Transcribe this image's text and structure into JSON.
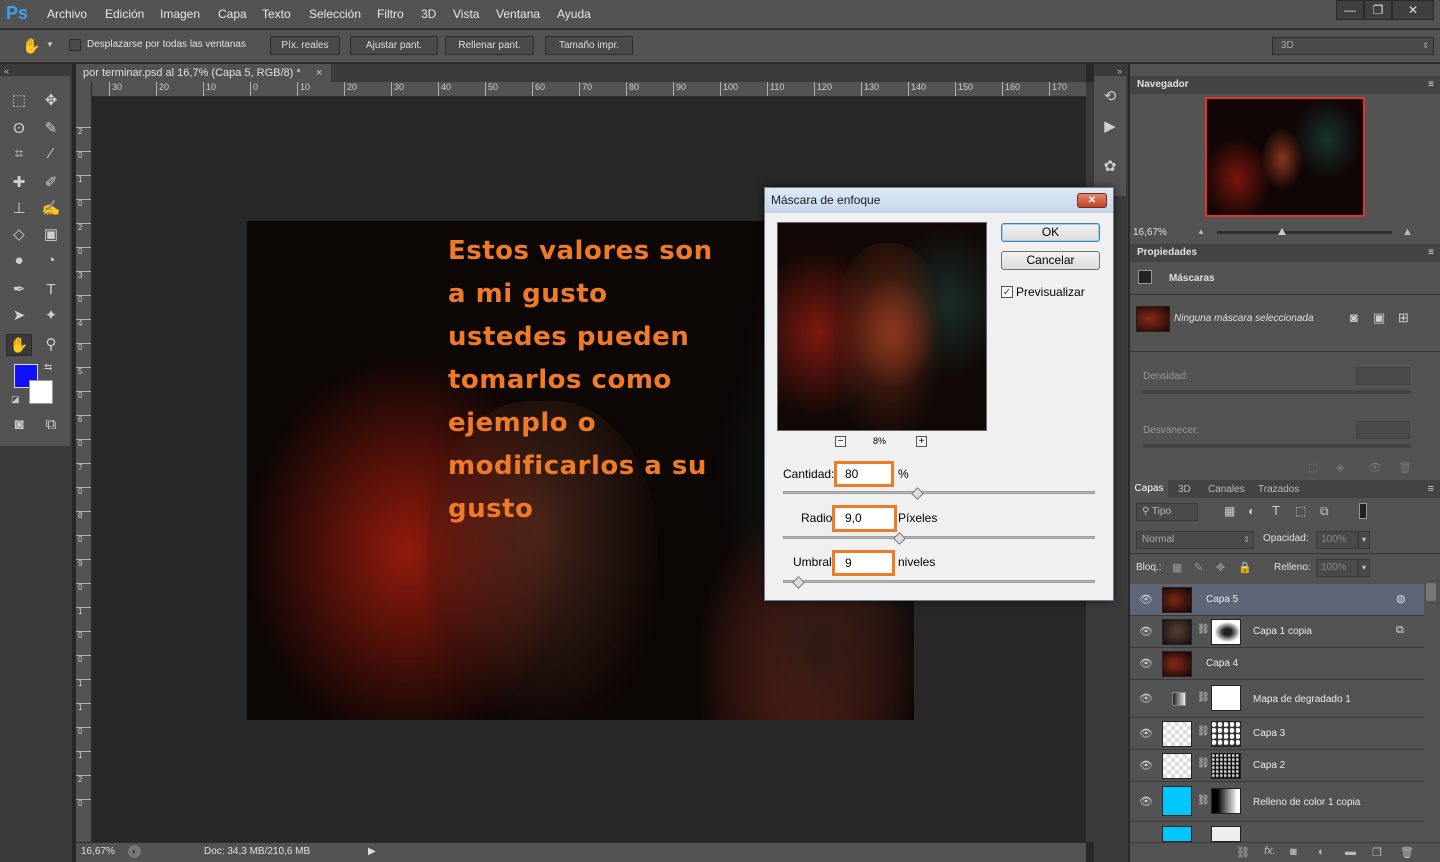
{
  "app": {
    "logo": "Ps"
  },
  "menu": [
    "Archivo",
    "Edición",
    "Imagen",
    "Capa",
    "Texto",
    "Selección",
    "Filtro",
    "3D",
    "Vista",
    "Ventana",
    "Ayuda"
  ],
  "window_controls": {
    "minimize": "—",
    "restore": "❐",
    "close": "✕"
  },
  "options_bar": {
    "scroll_all_label": "Desplazarse por todas las ventanas",
    "buttons": [
      "Píx. reales",
      "Ajustar pant.",
      "Rellenar pant.",
      "Tamaño impr."
    ],
    "workspace": "3D"
  },
  "document": {
    "tab_title": "por terminar.psd al 16,7% (Capa 5, RGB/8) *",
    "tab_close": "×",
    "ruler_h": [
      "30",
      "20",
      "10",
      "0",
      "10",
      "20",
      "30",
      "40",
      "50",
      "60",
      "70",
      "80",
      "90",
      "100",
      "110",
      "120",
      "130",
      "140",
      "150",
      "160",
      "170"
    ],
    "ruler_v": [
      "2",
      "0",
      "1",
      "0",
      "2",
      "0",
      "3",
      "0",
      "4",
      "0",
      "5",
      "0",
      "6",
      "0",
      "7",
      "0",
      "8",
      "0",
      "9",
      "0",
      "1",
      "0",
      "0",
      "1",
      "1",
      "0",
      "1",
      "2",
      "0"
    ],
    "overlay_text": [
      "Estos valores son",
      "a mi gusto",
      "ustedes pueden",
      "tomarlos como",
      "ejemplo o",
      "modificarlos a su",
      "gusto"
    ]
  },
  "status": {
    "zoom": "16,67%",
    "doc": "Doc: 34,3 MB/210,6 MB"
  },
  "dialog": {
    "title": "Máscara de enfoque",
    "ok": "OK",
    "cancel": "Cancelar",
    "preview_label": "Previsualizar",
    "preview_checked": true,
    "zoom": "8%",
    "amount_label": "Cantidad:",
    "amount_value": "80",
    "amount_unit": "%",
    "radius_label": "Radio:",
    "radius_value": "9,0",
    "radius_unit": "Píxeles",
    "threshold_label": "Umbral:",
    "threshold_value": "9",
    "threshold_unit": "niveles",
    "highlight_color": "#f07b27"
  },
  "navigator": {
    "title": "Navegador",
    "zoom": "16,67%"
  },
  "properties": {
    "title": "Propiedades",
    "section": "Máscaras",
    "mask_status": "Ninguna máscara seleccionada",
    "density_label": "Densidad:",
    "feather_label": "Desvanecer:"
  },
  "layers_panel": {
    "tabs": [
      "Capas",
      "3D",
      "Canales",
      "Trazados"
    ],
    "filter": "Tipo",
    "blend_mode": "Normal",
    "opacity_label": "Opacidad:",
    "opacity_value": "100%",
    "lock_label": "Bloq.:",
    "fill_label": "Relleno:",
    "fill_value": "100%",
    "layers": [
      {
        "name": "Capa 5",
        "selected": true
      },
      {
        "name": "Capa 1 copia",
        "selected": false
      },
      {
        "name": "Capa 4",
        "selected": false
      },
      {
        "name": "Mapa de degradado 1",
        "selected": false
      },
      {
        "name": "Capa 3",
        "selected": false
      },
      {
        "name": "Capa 2",
        "selected": false
      },
      {
        "name": "Relleno de color 1 copia",
        "selected": false
      }
    ]
  },
  "colors": {
    "foreground": "#1010ff",
    "background": "#ffffff",
    "accent": "#f07b27"
  }
}
